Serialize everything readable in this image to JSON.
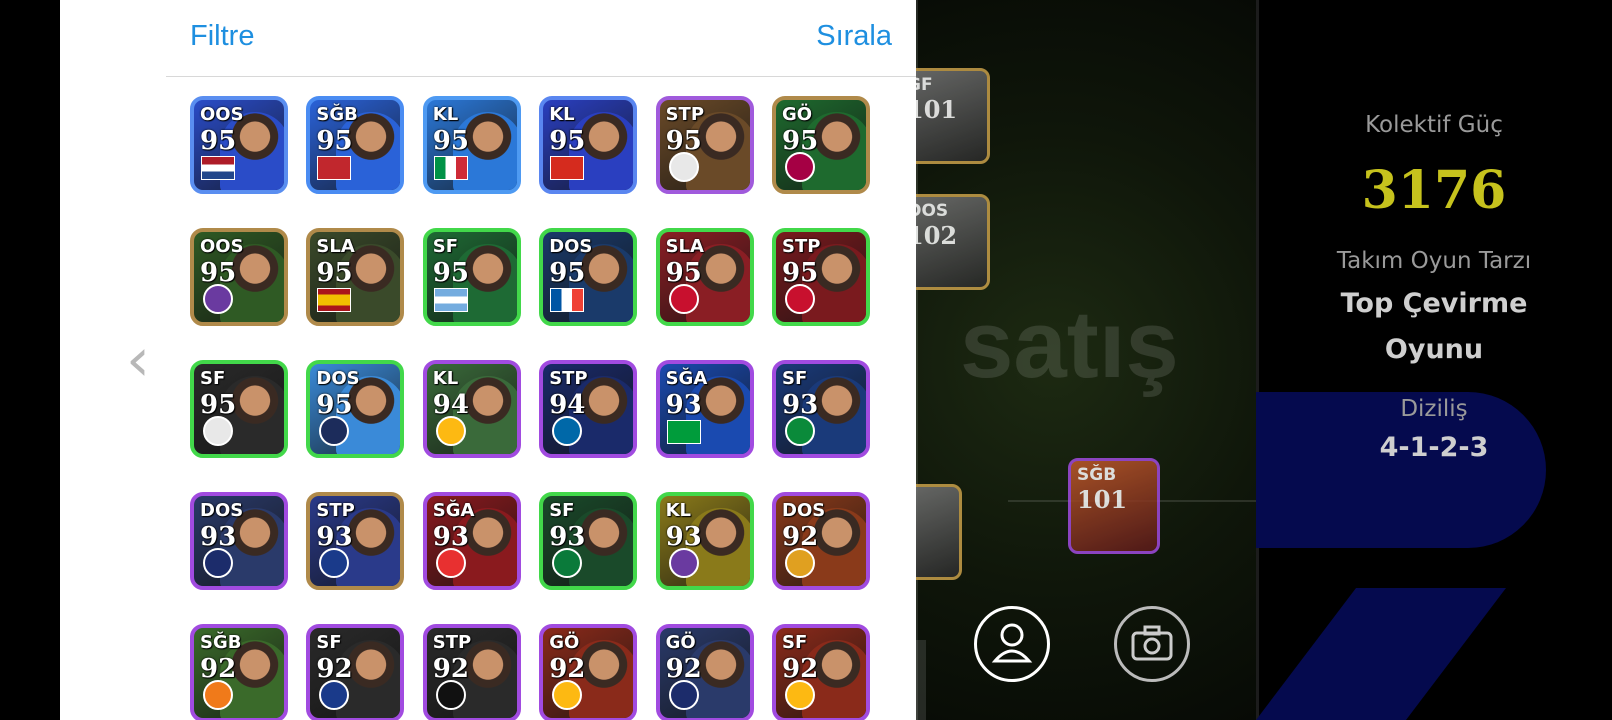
{
  "panel": {
    "filter_label": "Filtre",
    "sort_label": "Sırala"
  },
  "cards": [
    {
      "pos": "OOS",
      "rating": "95",
      "bg": "#2a4cc8",
      "border": "#5a8ef0",
      "flag": "netherlands"
    },
    {
      "pos": "SĞB",
      "rating": "95",
      "bg": "#2a62d8",
      "border": "#4a8cf2",
      "flag": "morocco"
    },
    {
      "pos": "KL",
      "rating": "95",
      "bg": "#2b78d8",
      "border": "#4e9af2",
      "flag": "italy"
    },
    {
      "pos": "KL",
      "rating": "95",
      "bg": "#2a3fc0",
      "border": "#5a86f0",
      "flag": "switzerland"
    },
    {
      "pos": "STP",
      "rating": "95",
      "bg": "#6a4a28",
      "border": "#a05adc",
      "flag": "club-real-madrid"
    },
    {
      "pos": "GÖ",
      "rating": "95",
      "bg": "#1e6a2e",
      "border": "#b08a4a",
      "flag": "club-barcelona"
    },
    {
      "pos": "OOS",
      "rating": "95",
      "bg": "#2f5a24",
      "border": "#b08a4a",
      "flag": "club-fiorentina"
    },
    {
      "pos": "SLA",
      "rating": "95",
      "bg": "#3a4a2a",
      "border": "#b08a4a",
      "flag": "spain"
    },
    {
      "pos": "SF",
      "rating": "95",
      "bg": "#1e6a34",
      "border": "#42d84a",
      "flag": "argentina"
    },
    {
      "pos": "DOS",
      "rating": "95",
      "bg": "#1a3a6a",
      "border": "#42d84a",
      "flag": "france"
    },
    {
      "pos": "SLA",
      "rating": "95",
      "bg": "#8a1e24",
      "border": "#42d84a",
      "flag": "club-liverpool"
    },
    {
      "pos": "STP",
      "rating": "95",
      "bg": "#7a1a1e",
      "border": "#42d84a",
      "flag": "club-liverpool"
    },
    {
      "pos": "SF",
      "rating": "95",
      "bg": "#2a2a2a",
      "border": "#42d84a",
      "flag": "club-real-madrid"
    },
    {
      "pos": "DOS",
      "rating": "95",
      "bg": "#3a8ad8",
      "border": "#42d84a",
      "flag": "club-man-city"
    },
    {
      "pos": "KL",
      "rating": "94",
      "bg": "#3a6a3a",
      "border": "#a14be0",
      "flag": "club-galatasaray"
    },
    {
      "pos": "STP",
      "rating": "94",
      "bg": "#1a2a6a",
      "border": "#a14be0",
      "flag": "club-inter"
    },
    {
      "pos": "SĞA",
      "rating": "93",
      "bg": "#1a4ab0",
      "border": "#a14be0",
      "flag": "brazil"
    },
    {
      "pos": "SF",
      "rating": "93",
      "bg": "#1a3a7a",
      "border": "#a14be0",
      "flag": "club-rizespor"
    },
    {
      "pos": "DOS",
      "rating": "93",
      "bg": "#2a3a6a",
      "border": "#a14be0",
      "flag": "club-fenerbahce"
    },
    {
      "pos": "STP",
      "rating": "93",
      "bg": "#2a3a8a",
      "border": "#b08a4a",
      "flag": "club-gent"
    },
    {
      "pos": "SĞA",
      "rating": "93",
      "bg": "#8a1a1e",
      "border": "#a14be0",
      "flag": "club-benfica"
    },
    {
      "pos": "SF",
      "rating": "93",
      "bg": "#1a4a2a",
      "border": "#42d84a",
      "flag": "club-sporting"
    },
    {
      "pos": "KL",
      "rating": "93",
      "bg": "#8a7a1a",
      "border": "#42d84a",
      "flag": "club-fiorentina"
    },
    {
      "pos": "DOS",
      "rating": "92",
      "bg": "#8a3a1a",
      "border": "#a14be0",
      "flag": "club-kayserispor"
    },
    {
      "pos": "SĞB",
      "rating": "92",
      "bg": "#3a6a2a",
      "border": "#a14be0",
      "flag": "club-alanyaspor"
    },
    {
      "pos": "SF",
      "rating": "92",
      "bg": "#2a2a2a",
      "border": "#a14be0",
      "flag": "club-kasimpasa"
    },
    {
      "pos": "STP",
      "rating": "92",
      "bg": "#2a2a2a",
      "border": "#a14be0",
      "flag": "club-besiktas"
    },
    {
      "pos": "GÖ",
      "rating": "92",
      "bg": "#8a2a1a",
      "border": "#a14be0",
      "flag": "club-galatasaray"
    },
    {
      "pos": "GÖ",
      "rating": "92",
      "bg": "#2a3a6a",
      "border": "#a14be0",
      "flag": "club-fenerbahce"
    },
    {
      "pos": "SF",
      "rating": "92",
      "bg": "#8a2a1a",
      "border": "#a14be0",
      "flag": "club-galatasaray"
    }
  ],
  "field_cards": [
    {
      "pos": "GF",
      "rating": "101"
    },
    {
      "pos": "OOS",
      "rating": "102"
    },
    {
      "pos": "SĞB",
      "rating": "101"
    }
  ],
  "watermark": "satış",
  "team_info": {
    "power_label": "Kolektif Güç",
    "power_value": "3176",
    "style_label": "Takım Oyun Tarzı",
    "style_value_line1": "Top Çevirme",
    "style_value_line2": "Oyunu",
    "formation_label": "Diziliş",
    "formation_value": "4-1-2-3"
  },
  "icons": {
    "back": "chevron-left-icon",
    "profile": "person-icon",
    "camera": "camera-icon"
  }
}
